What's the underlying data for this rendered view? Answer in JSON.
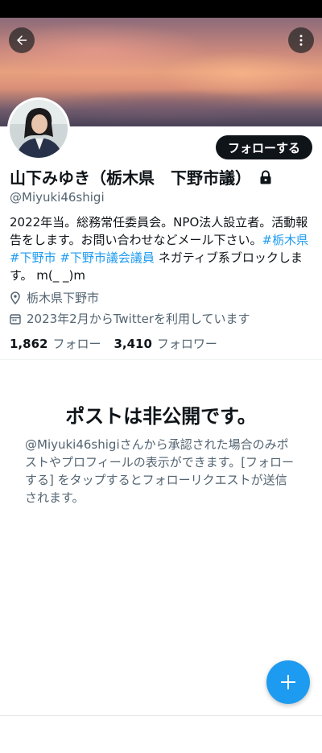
{
  "profile": {
    "display_name": "山下みゆき（栃木県　下野市議）",
    "handle": "@Miyuki46shigi",
    "bio_text": "2022年当。総務常任委員会。NPO法人設立者。活動報告をします。お問い合わせなどメール下さい。",
    "bio_hashtags": [
      "#栃木県",
      "#下野市",
      "#下野市議会議員"
    ],
    "bio_tail": "ネガティブ系ブロックします。 m(_ _)m",
    "location": "栃木県下野市",
    "joined": "2023年2月からTwitterを利用しています",
    "following_count": "1,862",
    "following_label": "フォロー",
    "followers_count": "3,410",
    "followers_label": "フォロワー"
  },
  "actions": {
    "follow_label": "フォローする"
  },
  "private_notice": {
    "title": "ポストは非公開です。",
    "description": "@Miyuki46shigiさんから承認された場合のみポストやプロフィールの表示ができます。[フォローする] をタップするとフォローリクエストが送信されます。"
  },
  "icons": {
    "back": "arrow-left-icon",
    "more": "more-vertical-icon",
    "lock": "lock-icon",
    "location": "location-pin-icon",
    "calendar": "calendar-icon",
    "compose": "plus-icon"
  },
  "colors": {
    "accent": "#1d9bf0",
    "text_primary": "#0f1419",
    "text_secondary": "#536471",
    "follow_button": "#0f1419"
  }
}
